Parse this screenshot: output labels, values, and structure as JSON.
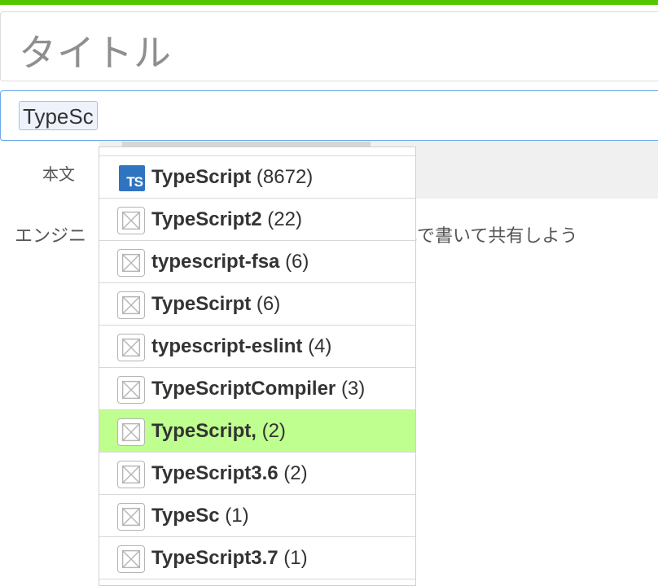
{
  "title_field": {
    "placeholder": "タイトル"
  },
  "tag_field": {
    "tag": "TypeSc"
  },
  "editor": {
    "tab_label": "本文",
    "placeholder_left": "エンジニ",
    "placeholder_right": "式で書いて共有しよう"
  },
  "colors": {
    "accent": "#55c500",
    "highlight": "#bfff8f",
    "ts_logo": "#2f74c0"
  },
  "suggestions": [
    {
      "name": "TypeScript",
      "count": "(8672)",
      "icon": "typescript-logo-icon"
    },
    {
      "name": "TypeScript2",
      "count": "(22)",
      "icon": "image-placeholder-icon"
    },
    {
      "name": "typescript-fsa",
      "count": "(6)",
      "icon": "image-placeholder-icon"
    },
    {
      "name": "TypeScirpt",
      "count": "(6)",
      "icon": "image-placeholder-icon"
    },
    {
      "name": "typescript-eslint",
      "count": "(4)",
      "icon": "image-placeholder-icon"
    },
    {
      "name": "TypeScriptCompiler",
      "count": "(3)",
      "icon": "image-placeholder-icon"
    },
    {
      "name": "TypeScript,",
      "count": "(2)",
      "icon": "image-placeholder-icon",
      "highlighted": true
    },
    {
      "name": "TypeScript3.6",
      "count": "(2)",
      "icon": "image-placeholder-icon"
    },
    {
      "name": "TypeSc",
      "count": "(1)",
      "icon": "image-placeholder-icon"
    },
    {
      "name": "TypeScript3.7",
      "count": "(1)",
      "icon": "image-placeholder-icon"
    }
  ]
}
